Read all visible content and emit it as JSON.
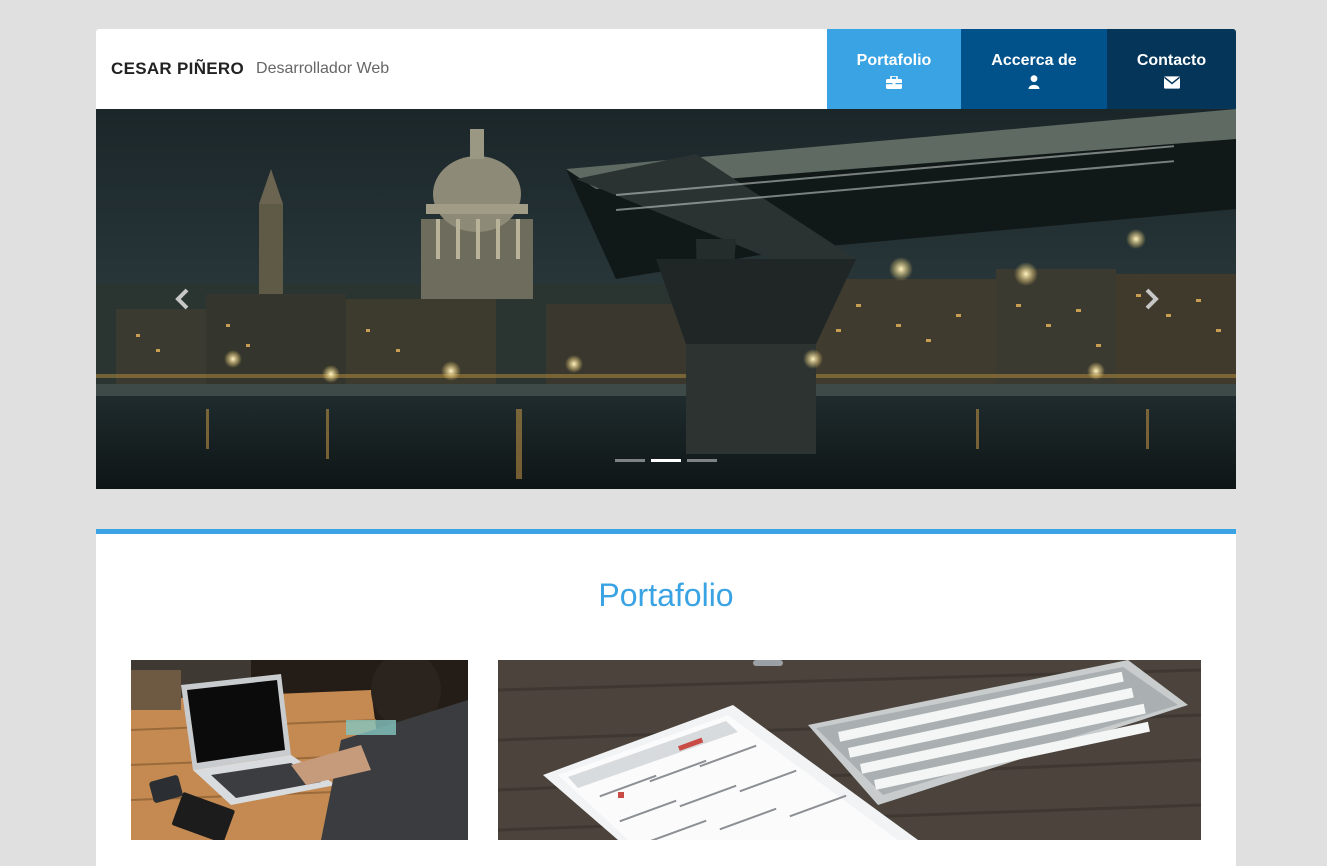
{
  "header": {
    "brand_name": "CESAR PIÑERO",
    "brand_subtitle": "Desarrollador Web"
  },
  "nav": [
    {
      "label": "Portafolio",
      "icon": "briefcase-icon",
      "color": "#3aa3e3"
    },
    {
      "label": "Accerca de",
      "icon": "user-icon",
      "color": "#01528a"
    },
    {
      "label": "Contacto",
      "icon": "envelope-icon",
      "color": "#053559"
    }
  ],
  "carousel": {
    "image": "london-night-skyline-millennium-bridge",
    "slide_count": 3,
    "active_slide": 2
  },
  "portfolio": {
    "title": "Portafolio",
    "accent_color": "#3aa3e3",
    "items": [
      {
        "image": "person-typing-on-laptop"
      },
      {
        "image": "tablet-calendar-and-keyboard"
      }
    ]
  }
}
